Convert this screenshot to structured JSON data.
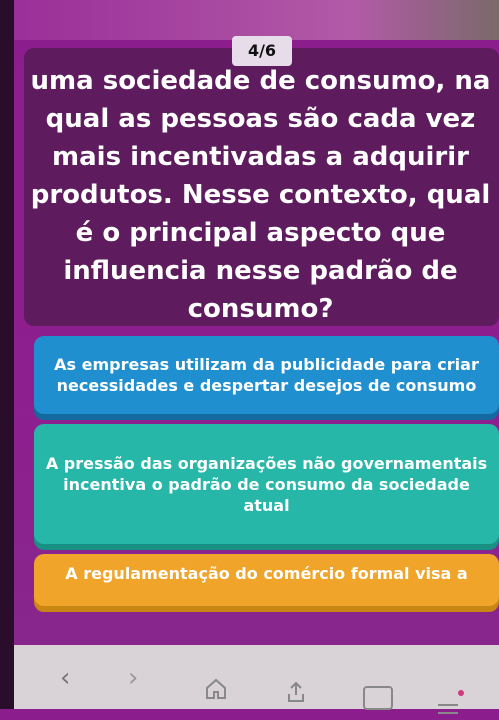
{
  "quiz": {
    "counter": "4/6",
    "question": "uma sociedade de consumo, na qual as pessoas são cada vez mais incentivadas a adquirir produtos. Nesse contexto, qual é o principal aspecto que influencia nesse padrão de consumo?",
    "answers": [
      {
        "label": "As empresas utilizam da publicidade para criar necessidades e despertar desejos de consumo",
        "color": "#1f8fd0"
      },
      {
        "label": "A pressão das organizações não governamentais incentiva o padrão de consumo da sociedade atual",
        "color": "#26b7a8"
      },
      {
        "label": "A regulamentação do comércio formal visa a",
        "color": "#f0a52a"
      }
    ]
  },
  "browser_bar": {
    "icons": [
      "back-icon",
      "forward-icon",
      "home-icon",
      "share-icon",
      "tabs-icon",
      "menu-icon"
    ],
    "tabs_count": ""
  }
}
